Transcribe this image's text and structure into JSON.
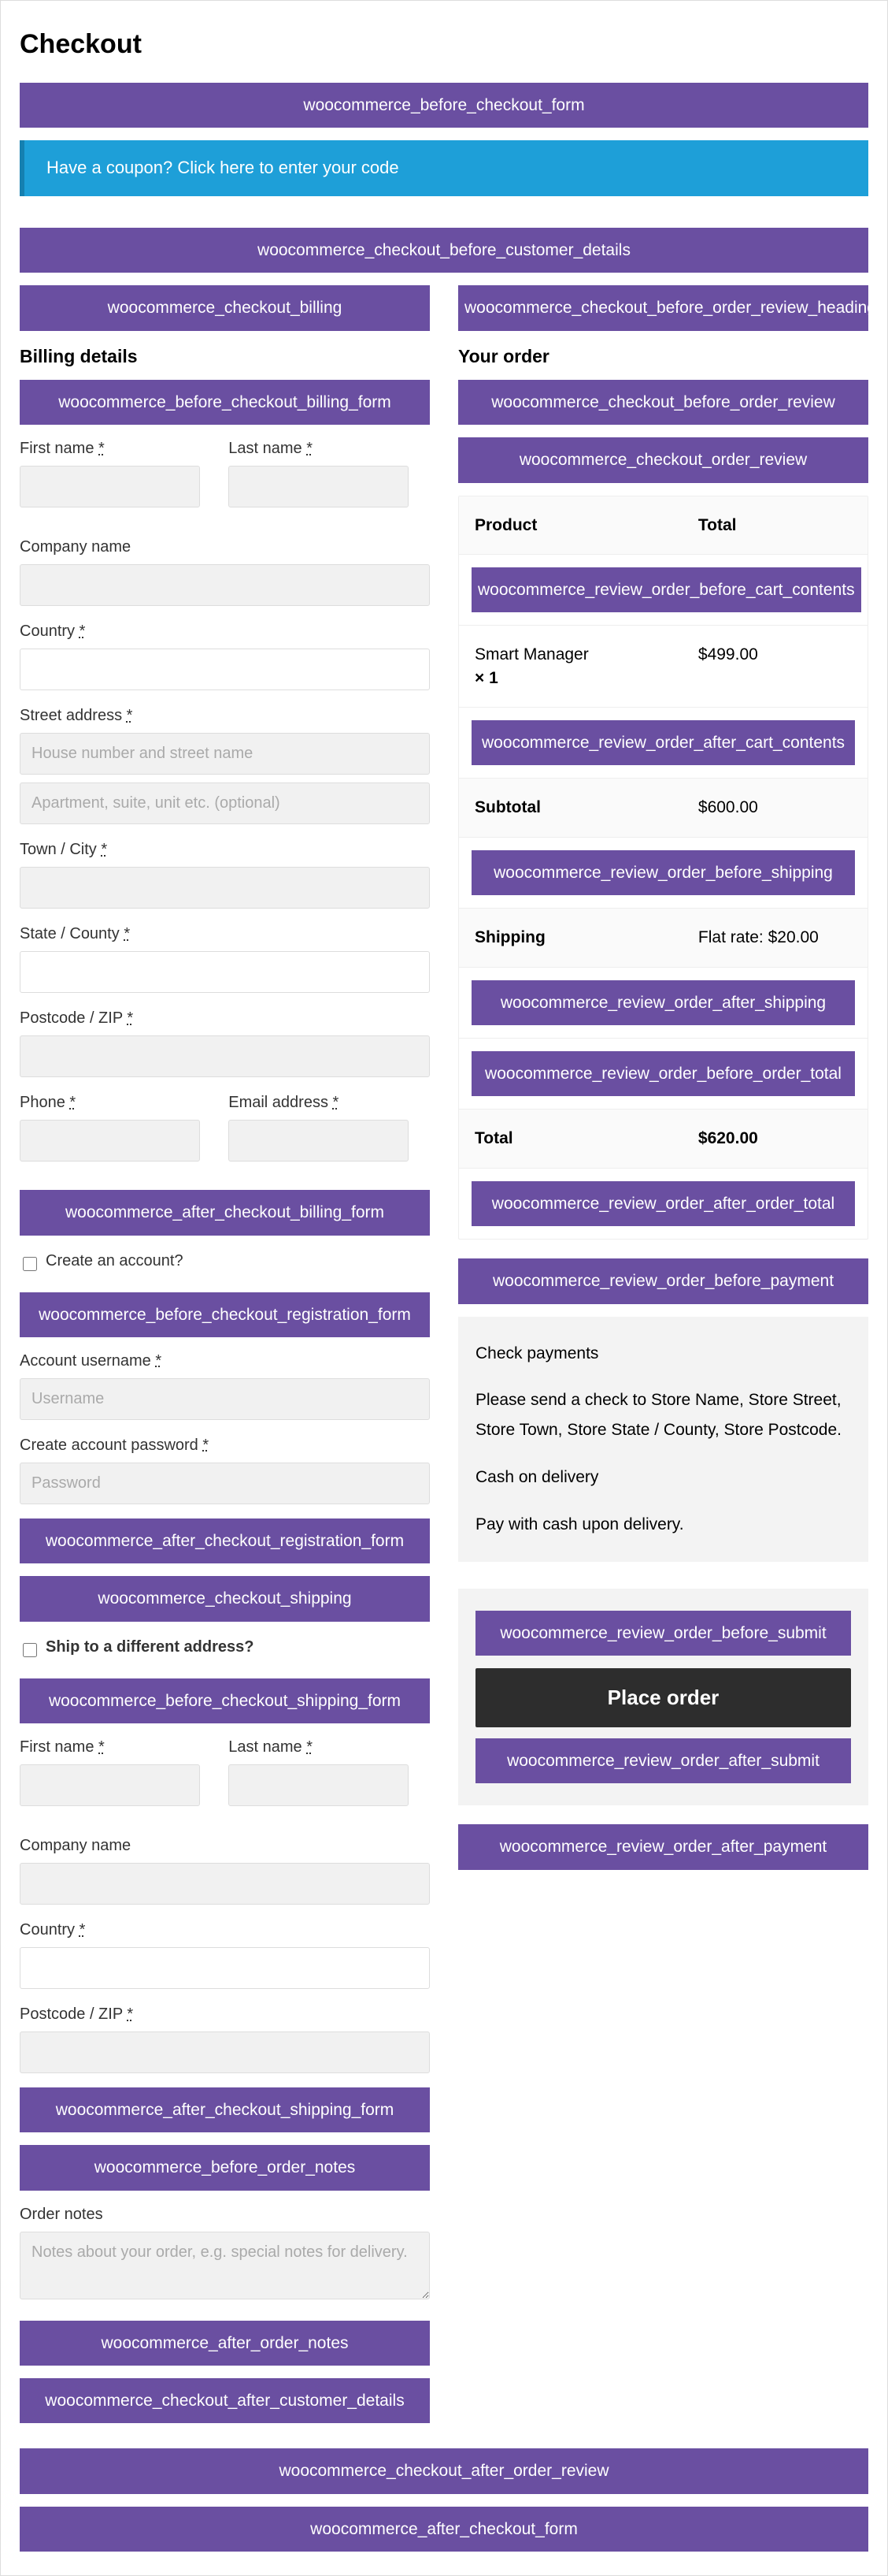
{
  "page_title": "Checkout",
  "hooks": {
    "before_checkout_form": "woocommerce_before_checkout_form",
    "coupon_notice": "Have a coupon? Click here to enter your code",
    "before_customer_details": "woocommerce_checkout_before_customer_details",
    "checkout_billing": "woocommerce_checkout_billing",
    "before_checkout_billing_form": "woocommerce_before_checkout_billing_form",
    "after_checkout_billing_form": "woocommerce_after_checkout_billing_form",
    "before_checkout_registration_form": "woocommerce_before_checkout_registration_form",
    "after_checkout_registration_form": "woocommerce_after_checkout_registration_form",
    "checkout_shipping": "woocommerce_checkout_shipping",
    "before_checkout_shipping_form": "woocommerce_before_checkout_shipping_form",
    "after_checkout_shipping_form": "woocommerce_after_checkout_shipping_form",
    "before_order_notes": "woocommerce_before_order_notes",
    "after_order_notes": "woocommerce_after_order_notes",
    "checkout_after_customer_details": "woocommerce_checkout_after_customer_details",
    "before_order_review_heading": "woocommerce_checkout_before_order_review_heading",
    "checkout_before_order_review": "woocommerce_checkout_before_order_review",
    "checkout_order_review": "woocommerce_checkout_order_review",
    "review_order_before_cart_contents": "woocommerce_review_order_before_cart_contents",
    "review_order_after_cart_contents": "woocommerce_review_order_after_cart_contents",
    "review_order_before_shipping": "woocommerce_review_order_before_shipping",
    "review_order_after_shipping": "woocommerce_review_order_after_shipping",
    "review_order_before_order_total": "woocommerce_review_order_before_order_total",
    "review_order_after_order_total": "woocommerce_review_order_after_order_total",
    "review_order_before_payment": "woocommerce_review_order_before_payment",
    "review_order_before_submit": "woocommerce_review_order_before_submit",
    "review_order_after_submit": "woocommerce_review_order_after_submit",
    "review_order_after_payment": "woocommerce_review_order_after_payment",
    "checkout_after_order_review": "woocommerce_checkout_after_order_review",
    "after_checkout_form": "woocommerce_after_checkout_form"
  },
  "billing": {
    "heading": "Billing details",
    "first_name": "First name",
    "last_name": "Last name",
    "company": "Company name",
    "country": "Country",
    "street": "Street address",
    "street_ph1": "House number and street name",
    "street_ph2": "Apartment, suite, unit etc. (optional)",
    "town": "Town / City",
    "state": "State / County",
    "postcode": "Postcode / ZIP",
    "phone": "Phone",
    "email": "Email address",
    "req": "*"
  },
  "account": {
    "create_label": "Create an account?",
    "username_label": "Account username",
    "username_ph": "Username",
    "password_label": "Create account password",
    "password_ph": "Password"
  },
  "shipping": {
    "ship_different": "Ship to a different address?",
    "first_name": "First name",
    "last_name": "Last name",
    "company": "Company name",
    "country": "Country",
    "postcode": "Postcode / ZIP",
    "order_notes": "Order notes",
    "order_notes_ph": "Notes about your order, e.g. special notes for delivery."
  },
  "order": {
    "heading": "Your order",
    "product_head": "Product",
    "total_head": "Total",
    "item_name": "Smart Manager",
    "item_qty": "× 1",
    "item_total": "$499.00",
    "subtotal_label": "Subtotal",
    "subtotal_val": "$600.00",
    "shipping_label": "Shipping",
    "shipping_val": "Flat rate: $20.00",
    "total_label": "Total",
    "total_val": "$620.00"
  },
  "payments": {
    "check_title": "Check payments",
    "check_desc": "Please send a check to Store Name, Store Street, Store Town, Store State / County, Store Postcode.",
    "cod_title": "Cash on delivery",
    "cod_desc": "Pay with cash upon delivery."
  },
  "place_order": "Place order"
}
